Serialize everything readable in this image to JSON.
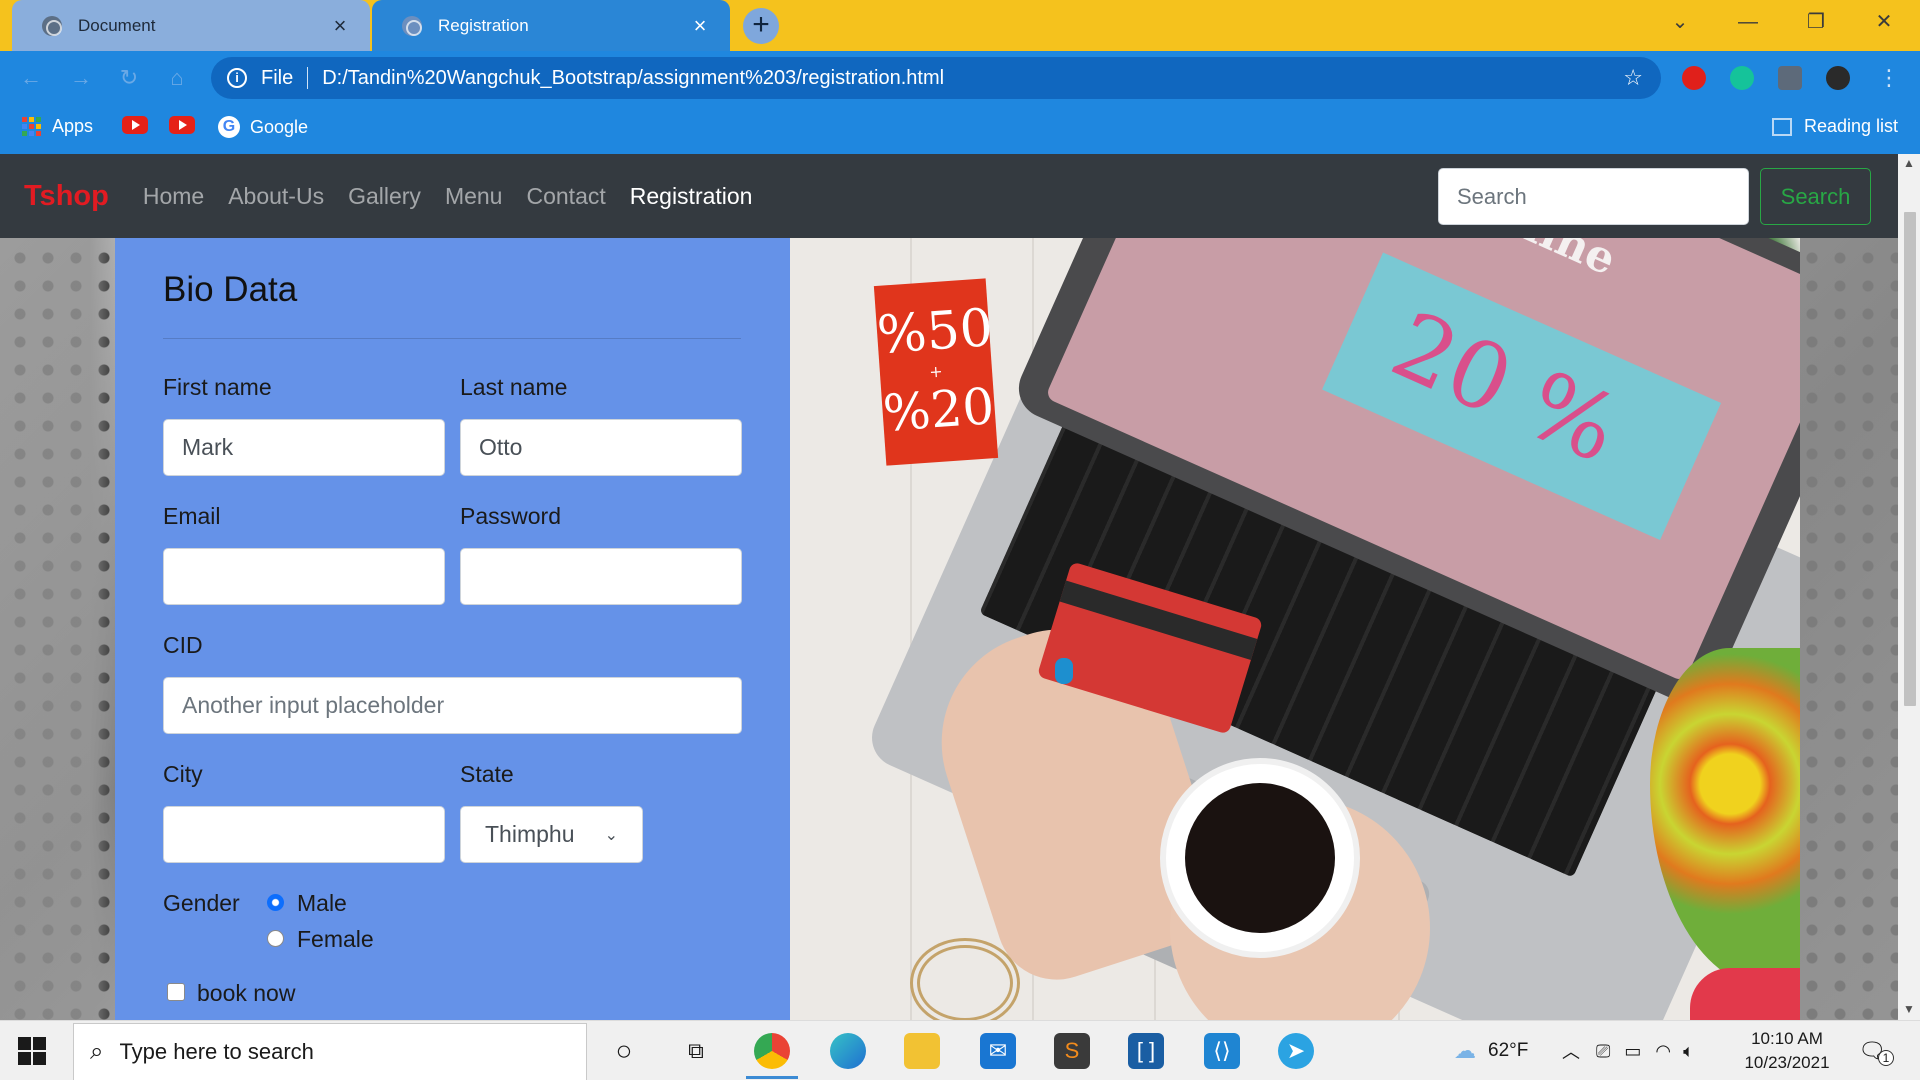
{
  "browser": {
    "tabs": [
      {
        "title": "Document",
        "active": false
      },
      {
        "title": "Registration",
        "active": true
      }
    ],
    "new_tab_symbol": "+",
    "window_controls": [
      "chevron-down-icon",
      "minimize-icon",
      "restore-icon",
      "close-icon"
    ],
    "omnibox": {
      "scheme_label": "File",
      "url": "D:/Tandin%20Wangchuk_Bootstrap/assignment%203/registration.html"
    },
    "bookmarks": [
      {
        "label": "Apps",
        "icon": "apps-grid-icon"
      },
      {
        "label": "",
        "icon": "youtube-icon"
      },
      {
        "label": "",
        "icon": "youtube-icon"
      },
      {
        "label": "Google",
        "icon": "google-icon"
      }
    ],
    "reading_list_label": "Reading list"
  },
  "site": {
    "brand": "Tshop",
    "nav_links": [
      {
        "label": "Home",
        "active": false
      },
      {
        "label": "About-Us",
        "active": false
      },
      {
        "label": "Gallery",
        "active": false
      },
      {
        "label": "Menu",
        "active": false
      },
      {
        "label": "Contact",
        "active": false
      },
      {
        "label": "Registration",
        "active": true
      }
    ],
    "search_placeholder": "Search",
    "search_button": "Search",
    "colors": {
      "navbar": "#343a40",
      "brand": "#e11b22",
      "form_bg": "#6592e8",
      "search_btn": "#28a745"
    }
  },
  "form": {
    "title": "Bio Data",
    "first_name_label": "First name",
    "first_name_value": "Mark",
    "last_name_label": "Last name",
    "last_name_value": "Otto",
    "email_label": "Email",
    "email_value": "",
    "password_label": "Password",
    "password_value": "",
    "cid_label": "CID",
    "cid_placeholder": "Another input placeholder",
    "city_label": "City",
    "city_value": "",
    "state_label": "State",
    "state_selected": "Thimphu",
    "gender_label": "Gender",
    "gender_options": [
      {
        "label": "Male",
        "checked": true
      },
      {
        "label": "Female",
        "checked": false
      }
    ],
    "book_now_label": "book now",
    "book_now_checked": false
  },
  "hero_image": {
    "tag_top": "%50",
    "tag_mid": "+",
    "tag_bottom": "%20",
    "screen_heading": "Shopping online",
    "screen_discount": "20 %"
  },
  "taskbar": {
    "search_placeholder": "Type here to search",
    "pinned_apps": [
      "cortana-icon",
      "task-view-icon",
      "chrome-icon",
      "edge-icon",
      "file-explorer-icon",
      "mail-icon",
      "sublime-text-icon",
      "brackets-icon",
      "vscode-icon",
      "telegram-icon"
    ],
    "weather": "62°F",
    "time": "10:10 AM",
    "date": "10/23/2021",
    "notification_count": "1"
  }
}
